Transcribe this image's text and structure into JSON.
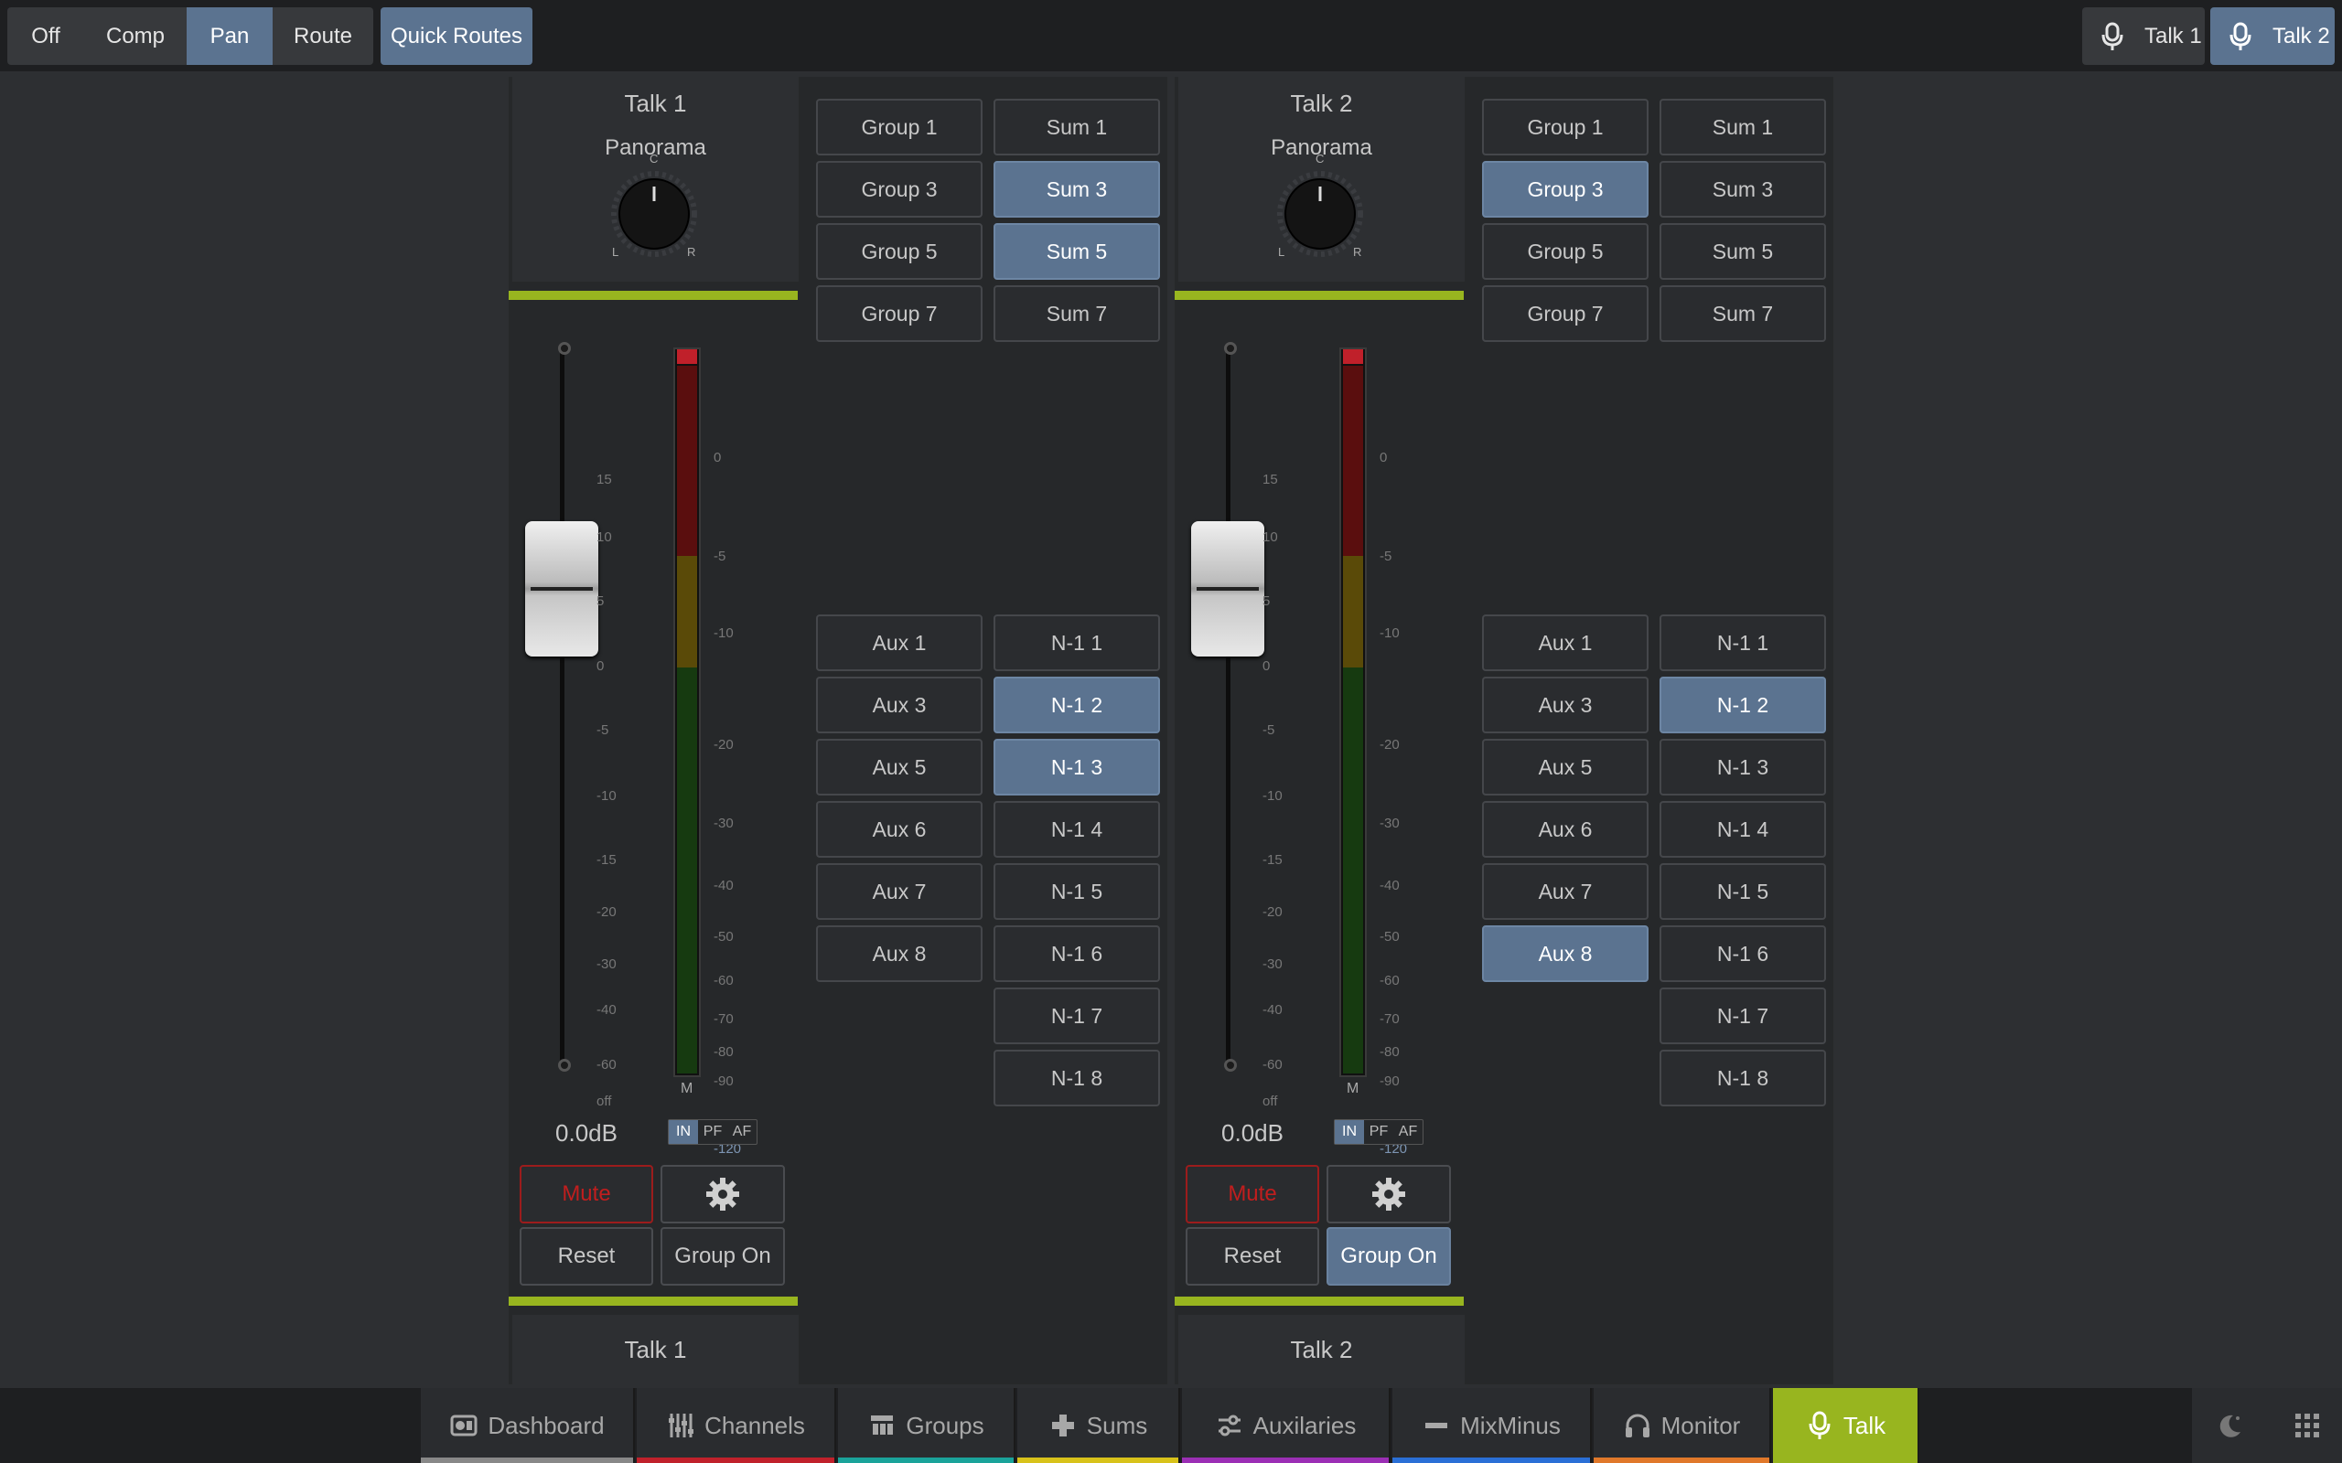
{
  "topbar": {
    "modes": [
      {
        "label": "Off",
        "active": false
      },
      {
        "label": "Comp",
        "active": false
      },
      {
        "label": "Pan",
        "active": true
      },
      {
        "label": "Route",
        "active": false
      }
    ],
    "quick_routes": "Quick Routes",
    "talk_buttons": [
      {
        "label": "Talk 1",
        "active": false,
        "icon": "microphone-icon"
      },
      {
        "label": "Talk 2",
        "active": true,
        "icon": "microphone-icon"
      }
    ]
  },
  "strips": [
    {
      "name": "Talk 1",
      "panorama_label": "Panorama",
      "knob_labels": {
        "c": "C",
        "l": "L",
        "r": "R"
      },
      "fader_value": "0.0dB",
      "fader_scale": [
        "15",
        "10",
        "5",
        "0",
        "-5",
        "-10",
        "-15",
        "-20",
        "-30",
        "-40",
        "-60",
        "off"
      ],
      "meter_scale": [
        "0",
        "-5",
        "-10",
        "-20",
        "-30",
        "-40",
        "-50",
        "-60",
        "-70",
        "-80",
        "-90",
        "-120"
      ],
      "meter_label": "M",
      "source": [
        {
          "label": "IN",
          "active": true
        },
        {
          "label": "PF",
          "active": false
        },
        {
          "label": "AF",
          "active": false
        }
      ],
      "mute_label": "Mute",
      "settings_icon": "gear-icon",
      "reset_label": "Reset",
      "group_on": {
        "label": "Group On",
        "active": false
      },
      "footer_name": "Talk 1",
      "groups": [
        {
          "label": "Group 1",
          "active": false
        },
        {
          "label": "Group 3",
          "active": false
        },
        {
          "label": "Group 5",
          "active": false
        },
        {
          "label": "Group 7",
          "active": false
        }
      ],
      "sums": [
        {
          "label": "Sum 1",
          "active": false
        },
        {
          "label": "Sum 3",
          "active": true
        },
        {
          "label": "Sum 5",
          "active": true
        },
        {
          "label": "Sum 7",
          "active": false
        }
      ],
      "auxes": [
        {
          "label": "Aux 1",
          "active": false
        },
        {
          "label": "Aux 3",
          "active": false
        },
        {
          "label": "Aux 5",
          "active": false
        },
        {
          "label": "Aux 6",
          "active": false
        },
        {
          "label": "Aux 7",
          "active": false
        },
        {
          "label": "Aux 8",
          "active": false
        }
      ],
      "n1": [
        {
          "label": "N-1 1",
          "active": false
        },
        {
          "label": "N-1 2",
          "active": true
        },
        {
          "label": "N-1 3",
          "active": true
        },
        {
          "label": "N-1 4",
          "active": false
        },
        {
          "label": "N-1 5",
          "active": false
        },
        {
          "label": "N-1 6",
          "active": false
        },
        {
          "label": "N-1 7",
          "active": false
        },
        {
          "label": "N-1 8",
          "active": false
        }
      ]
    },
    {
      "name": "Talk 2",
      "panorama_label": "Panorama",
      "knob_labels": {
        "c": "C",
        "l": "L",
        "r": "R"
      },
      "fader_value": "0.0dB",
      "fader_scale": [
        "15",
        "10",
        "5",
        "0",
        "-5",
        "-10",
        "-15",
        "-20",
        "-30",
        "-40",
        "-60",
        "off"
      ],
      "meter_scale": [
        "0",
        "-5",
        "-10",
        "-20",
        "-30",
        "-40",
        "-50",
        "-60",
        "-70",
        "-80",
        "-90",
        "-120"
      ],
      "meter_label": "M",
      "source": [
        {
          "label": "IN",
          "active": true
        },
        {
          "label": "PF",
          "active": false
        },
        {
          "label": "AF",
          "active": false
        }
      ],
      "mute_label": "Mute",
      "settings_icon": "gear-icon",
      "reset_label": "Reset",
      "group_on": {
        "label": "Group On",
        "active": true
      },
      "footer_name": "Talk 2",
      "groups": [
        {
          "label": "Group 1",
          "active": false
        },
        {
          "label": "Group 3",
          "active": true
        },
        {
          "label": "Group 5",
          "active": false
        },
        {
          "label": "Group 7",
          "active": false
        }
      ],
      "sums": [
        {
          "label": "Sum 1",
          "active": false
        },
        {
          "label": "Sum 3",
          "active": false
        },
        {
          "label": "Sum 5",
          "active": false
        },
        {
          "label": "Sum 7",
          "active": false
        }
      ],
      "auxes": [
        {
          "label": "Aux 1",
          "active": false
        },
        {
          "label": "Aux 3",
          "active": false
        },
        {
          "label": "Aux 5",
          "active": false
        },
        {
          "label": "Aux 6",
          "active": false
        },
        {
          "label": "Aux 7",
          "active": false
        },
        {
          "label": "Aux 8",
          "active": true
        }
      ],
      "n1": [
        {
          "label": "N-1 1",
          "active": false
        },
        {
          "label": "N-1 2",
          "active": true
        },
        {
          "label": "N-1 3",
          "active": false
        },
        {
          "label": "N-1 4",
          "active": false
        },
        {
          "label": "N-1 5",
          "active": false
        },
        {
          "label": "N-1 6",
          "active": false
        },
        {
          "label": "N-1 7",
          "active": false
        },
        {
          "label": "N-1 8",
          "active": false
        }
      ]
    }
  ],
  "nav": [
    {
      "label": "Dashboard",
      "icon": "dashboard-icon",
      "color": "#888888",
      "active": false
    },
    {
      "label": "Channels",
      "icon": "channels-icon",
      "color": "#c0212b",
      "active": false
    },
    {
      "label": "Groups",
      "icon": "groups-icon",
      "color": "#1aa39a",
      "active": false
    },
    {
      "label": "Sums",
      "icon": "plus-icon",
      "color": "#d8c21a",
      "active": false
    },
    {
      "label": "Auxilaries",
      "icon": "auxiliaries-icon",
      "color": "#9b2fb5",
      "active": false
    },
    {
      "label": "MixMinus",
      "icon": "minus-icon",
      "color": "#2a6fd6",
      "active": false
    },
    {
      "label": "Monitor",
      "icon": "headphones-icon",
      "color": "#e0782a",
      "active": false
    },
    {
      "label": "Talk",
      "icon": "microphone-icon",
      "color": "#98b51f",
      "active": true
    }
  ],
  "nav_right": [
    {
      "icon": "night-mode-icon"
    },
    {
      "icon": "apps-grid-icon"
    }
  ],
  "colors": {
    "accent": "#5b7390",
    "green_bar": "#98b51f",
    "mute_red": "#c01e1e"
  }
}
